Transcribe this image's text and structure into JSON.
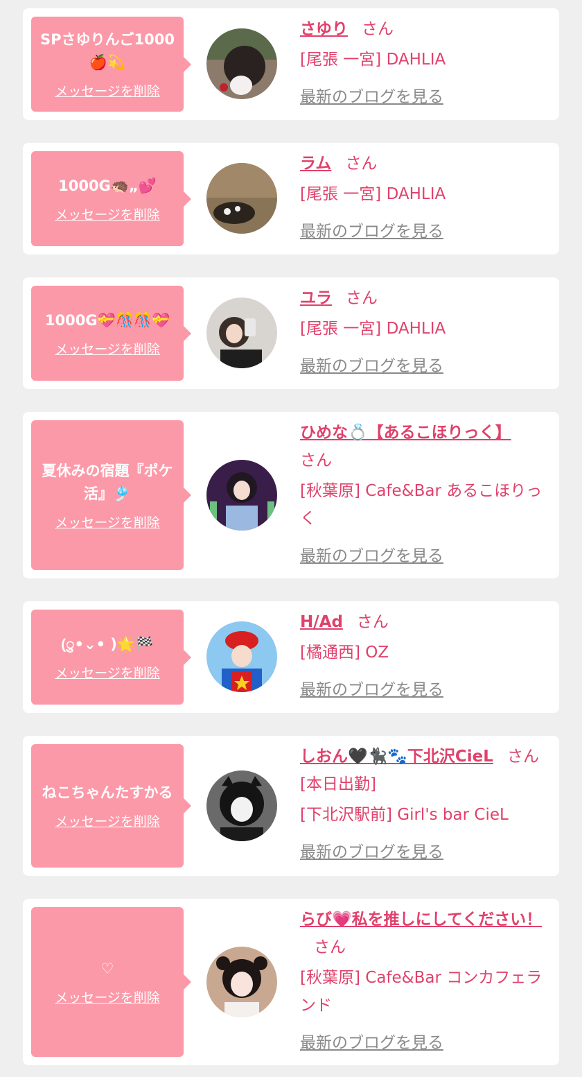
{
  "colors": {
    "page_bg": "#efefef",
    "card_bg": "#ffffff",
    "bubble_bg": "#fc99a8",
    "accent": "#e0416b",
    "muted": "#8a8a8a"
  },
  "entries": [
    {
      "message": "SPさゆりんご1000🍎💫",
      "delete_label": "メッセージを削除",
      "name": "さゆり",
      "honorific": "さん",
      "shop": "[尾張 一宮] DAHLIA",
      "blog_label": "最新のブログを見る",
      "avatar_icon": "avatar-photo"
    },
    {
      "message": "1000G🦔„💕",
      "delete_label": "メッセージを削除",
      "name": "ラム",
      "honorific": "さん",
      "shop": "[尾張 一宮] DAHLIA",
      "blog_label": "最新のブログを見る",
      "avatar_icon": "avatar-photo"
    },
    {
      "message": "1000G💝🎊🎊💝",
      "delete_label": "メッセージを削除",
      "name": "ユラ",
      "honorific": "さん",
      "shop": "[尾張 一宮] DAHLIA",
      "blog_label": "最新のブログを見る",
      "avatar_icon": "avatar-photo"
    },
    {
      "message": "夏休みの宿題『ポケ活』🎐",
      "delete_label": "メッセージを削除",
      "name": "ひめな💍【あるこほりっく】",
      "honorific": "さん",
      "shop": "[秋葉原] Cafe&Bar あるこほりっく",
      "blog_label": "最新のブログを見る",
      "avatar_icon": "avatar-photo"
    },
    {
      "message": "(ु•⌄• )🌟🏁",
      "delete_label": "メッセージを削除",
      "name": "H/Ad",
      "honorific": "さん",
      "shop": "[橘通西] OZ",
      "blog_label": "最新のブログを見る",
      "avatar_icon": "avatar-photo"
    },
    {
      "message": "ねこちゃんたすかる",
      "delete_label": "メッセージを削除",
      "name": "しおん🖤🐈‍⬛🐾下北沢CieL",
      "honorific": "さん[本日出勤]",
      "shop": "[下北沢駅前] Girl's bar CieL",
      "blog_label": "最新のブログを見る",
      "avatar_icon": "avatar-photo"
    },
    {
      "message": "♡",
      "delete_label": "メッセージを削除",
      "name": "らび💗私を推しにしてください！",
      "honorific": "さん",
      "shop": "[秋葉原] Cafe&Bar コンカフェランド",
      "blog_label": "最新のブログを見る",
      "avatar_icon": "avatar-photo"
    }
  ]
}
